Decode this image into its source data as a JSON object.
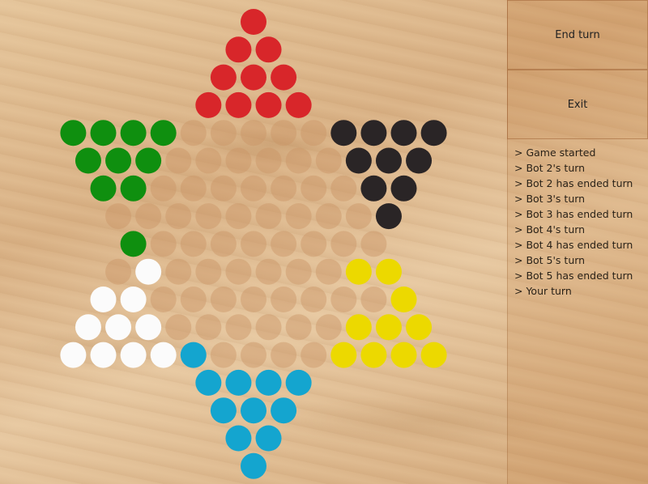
{
  "controls": {
    "end_turn_label": "End turn",
    "exit_label": "Exit"
  },
  "log": [
    "> Game started",
    "> Bot 2's turn",
    "> Bot 2 has ended turn",
    "> Bot 3's turn",
    "> Bot 3 has ended turn",
    "> Bot 4's turn",
    "> Bot 4 has ended turn",
    "> Bot 5's turn",
    "> Bot 5 has ended turn",
    "> Your turn"
  ],
  "colors": {
    "empty_hole": "#c99566",
    "red": "#d8262a",
    "green": "#0f8f0f",
    "black": "#2a2526",
    "white": "#fbfbfb",
    "yellow": "#ecd900",
    "blue": "#14a5cf"
  },
  "board": {
    "pieces": {
      "red": [
        [
          0,
          0
        ],
        [
          1,
          -1
        ],
        [
          1,
          1
        ],
        [
          2,
          -2
        ],
        [
          2,
          0
        ],
        [
          2,
          2
        ],
        [
          3,
          -3
        ],
        [
          3,
          -1
        ],
        [
          3,
          1
        ],
        [
          3,
          3
        ]
      ],
      "green": [
        [
          4,
          -12
        ],
        [
          4,
          -10
        ],
        [
          4,
          -8
        ],
        [
          4,
          -6
        ],
        [
          5,
          -11
        ],
        [
          5,
          -9
        ],
        [
          5,
          -7
        ],
        [
          6,
          -10
        ],
        [
          6,
          -8
        ],
        [
          8,
          -8
        ]
      ],
      "black": [
        [
          4,
          6
        ],
        [
          4,
          8
        ],
        [
          4,
          10
        ],
        [
          4,
          12
        ],
        [
          5,
          7
        ],
        [
          5,
          9
        ],
        [
          5,
          11
        ],
        [
          6,
          8
        ],
        [
          6,
          10
        ],
        [
          7,
          9
        ]
      ],
      "white": [
        [
          9,
          -7
        ],
        [
          10,
          -10
        ],
        [
          10,
          -8
        ],
        [
          11,
          -11
        ],
        [
          11,
          -9
        ],
        [
          11,
          -7
        ],
        [
          12,
          -12
        ],
        [
          12,
          -10
        ],
        [
          12,
          -8
        ],
        [
          12,
          -6
        ]
      ],
      "yellow": [
        [
          9,
          7
        ],
        [
          9,
          9
        ],
        [
          10,
          10
        ],
        [
          11,
          7
        ],
        [
          11,
          9
        ],
        [
          11,
          11
        ],
        [
          12,
          6
        ],
        [
          12,
          8
        ],
        [
          12,
          10
        ],
        [
          12,
          12
        ]
      ],
      "blue": [
        [
          12,
          -4
        ],
        [
          13,
          -3
        ],
        [
          13,
          -1
        ],
        [
          13,
          1
        ],
        [
          13,
          3
        ],
        [
          14,
          -2
        ],
        [
          14,
          0
        ],
        [
          14,
          2
        ],
        [
          15,
          -1
        ],
        [
          15,
          1
        ],
        [
          16,
          0
        ]
      ]
    }
  }
}
